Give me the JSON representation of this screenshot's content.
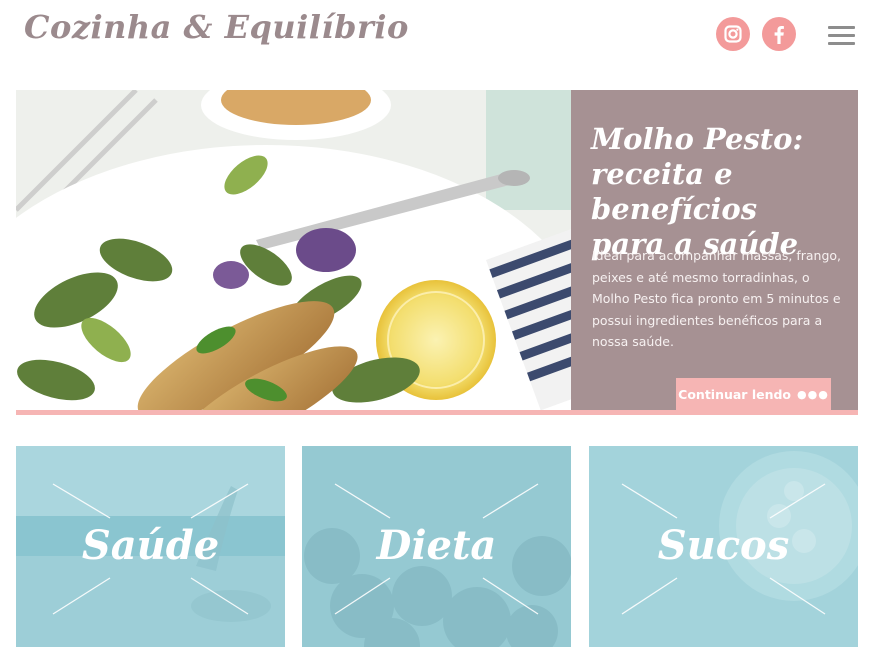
{
  "header": {
    "logo": "Cozinha & Equilíbrio",
    "social": [
      {
        "name": "instagram",
        "icon": "instagram-icon"
      },
      {
        "name": "facebook",
        "icon": "facebook-icon"
      }
    ],
    "menu_icon": "hamburger-menu-icon"
  },
  "hero": {
    "title_lines": [
      "Molho Pesto:",
      "receita e benefícios",
      "para a saúde"
    ],
    "description": "Ideal para acompanhar massas, frango, peixes e até mesmo torradinhas, o Molho Pesto fica pronto em 5 minutos e possui ingredientes benéficos para a nossa saúde.",
    "button_label": "Continuar lendo",
    "button_dots": "●●●"
  },
  "categories": [
    {
      "label": "Saúde"
    },
    {
      "label": "Dieta"
    },
    {
      "label": "Sucos"
    }
  ],
  "colors": {
    "logo": "#9b8a8d",
    "accent_pink": "#f6b5b4",
    "social_bg": "#f39a9a",
    "hero_panel": "#a69193",
    "card_overlay": "#9fd1d9",
    "menu_icon": "#8d8d8d"
  }
}
